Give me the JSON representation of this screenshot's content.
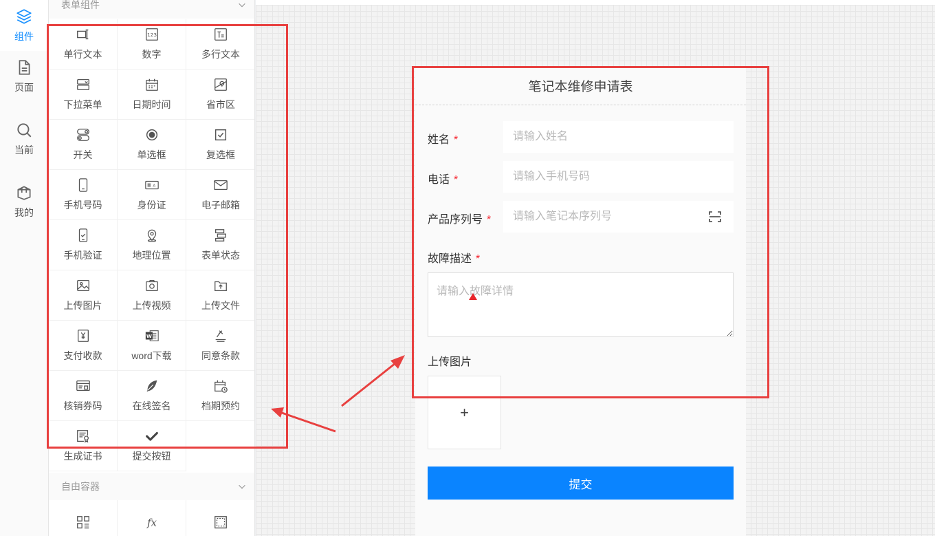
{
  "nav_rail": {
    "items": [
      {
        "label": "组件",
        "icon": "layers-icon",
        "active": true
      },
      {
        "label": "页面",
        "icon": "document-icon",
        "active": false
      },
      {
        "label": "当前",
        "icon": "search-icon",
        "active": false
      },
      {
        "label": "我的",
        "icon": "box-icon",
        "active": false
      }
    ]
  },
  "panel": {
    "form_group_title": "表单组件",
    "container_group_title": "自由容器",
    "components": [
      {
        "label": "单行文本",
        "icon": "single-line-text-icon"
      },
      {
        "label": "数字",
        "icon": "number-icon"
      },
      {
        "label": "多行文本",
        "icon": "multiline-text-icon"
      },
      {
        "label": "下拉菜单",
        "icon": "dropdown-icon"
      },
      {
        "label": "日期时间",
        "icon": "calendar-icon"
      },
      {
        "label": "省市区",
        "icon": "map-region-icon"
      },
      {
        "label": "开关",
        "icon": "toggle-icon"
      },
      {
        "label": "单选框",
        "icon": "radio-icon"
      },
      {
        "label": "复选框",
        "icon": "checkbox-icon"
      },
      {
        "label": "手机号码",
        "icon": "mobile-phone-icon"
      },
      {
        "label": "身份证",
        "icon": "id-card-icon"
      },
      {
        "label": "电子邮箱",
        "icon": "email-icon"
      },
      {
        "label": "手机验证",
        "icon": "phone-verify-icon"
      },
      {
        "label": "地理位置",
        "icon": "location-pin-icon"
      },
      {
        "label": "表单状态",
        "icon": "form-status-icon"
      },
      {
        "label": "上传图片",
        "icon": "image-upload-icon"
      },
      {
        "label": "上传视频",
        "icon": "video-upload-icon"
      },
      {
        "label": "上传文件",
        "icon": "file-upload-icon"
      },
      {
        "label": "支付收款",
        "icon": "payment-icon"
      },
      {
        "label": "word下载",
        "icon": "word-icon"
      },
      {
        "label": "同意条款",
        "icon": "agreement-icon"
      },
      {
        "label": "核销券码",
        "icon": "coupon-icon"
      },
      {
        "label": "在线签名",
        "icon": "feather-pen-icon"
      },
      {
        "label": "档期预约",
        "icon": "schedule-icon"
      },
      {
        "label": "生成证书",
        "icon": "certificate-icon"
      },
      {
        "label": "提交按钮",
        "icon": "check-icon"
      }
    ],
    "containers": [
      {
        "label": "",
        "icon": "grid-icon"
      },
      {
        "label": "",
        "icon": "formula-icon"
      },
      {
        "label": "",
        "icon": "frame-icon"
      }
    ]
  },
  "form": {
    "title": "笔记本维修申请表",
    "required_mark": "*",
    "name": {
      "label": "姓名",
      "placeholder": "请输入姓名"
    },
    "phone": {
      "label": "电话",
      "placeholder": "请输入手机号码"
    },
    "serial": {
      "label": "产品序列号",
      "placeholder": "请输入笔记本序列号"
    },
    "fault": {
      "label": "故障描述",
      "placeholder": "请输入故障详情"
    },
    "upload": {
      "label": "上传图片",
      "plus": "+"
    },
    "submit_label": "提交"
  },
  "annotations": {
    "color": "#e8403f"
  },
  "colors": {
    "accent": "#1890ff",
    "submit": "#0a84ff",
    "required": "#f5222d"
  }
}
